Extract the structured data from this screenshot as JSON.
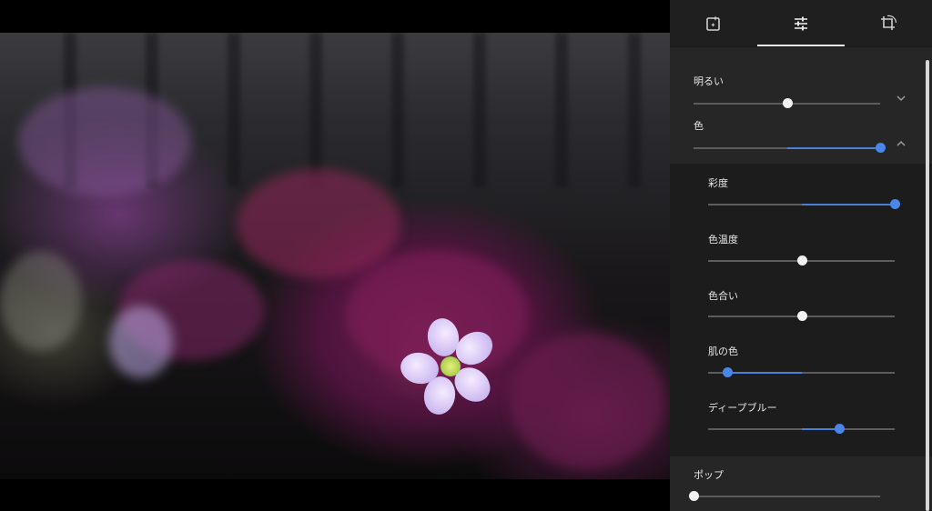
{
  "tabs": [
    {
      "name": "filters-tab",
      "icon": "photo-filter-icon"
    },
    {
      "name": "adjust-tab",
      "icon": "sliders-icon"
    },
    {
      "name": "crop-rotate-tab",
      "icon": "crop-rotate-icon"
    }
  ],
  "active_tab": "adjust-tab",
  "adjust": {
    "light": {
      "label": "明るい",
      "value": 0.5,
      "expanded": false
    },
    "color": {
      "label": "色",
      "value": 1.0,
      "expanded": true
    },
    "saturation": {
      "label": "彩度",
      "value": 1.0
    },
    "warmth": {
      "label": "色温度",
      "value": 0.5
    },
    "tint": {
      "label": "色合い",
      "value": 0.5
    },
    "skin_tone": {
      "label": "肌の色",
      "value": 0.1
    },
    "deep_blue": {
      "label": "ディープブルー",
      "value": 0.7
    },
    "pop": {
      "label": "ポップ",
      "value": 0.0
    }
  },
  "colors": {
    "accent": "#4a7fd6",
    "panel_bg": "#262626",
    "sub_bg": "#1c1c1c"
  }
}
